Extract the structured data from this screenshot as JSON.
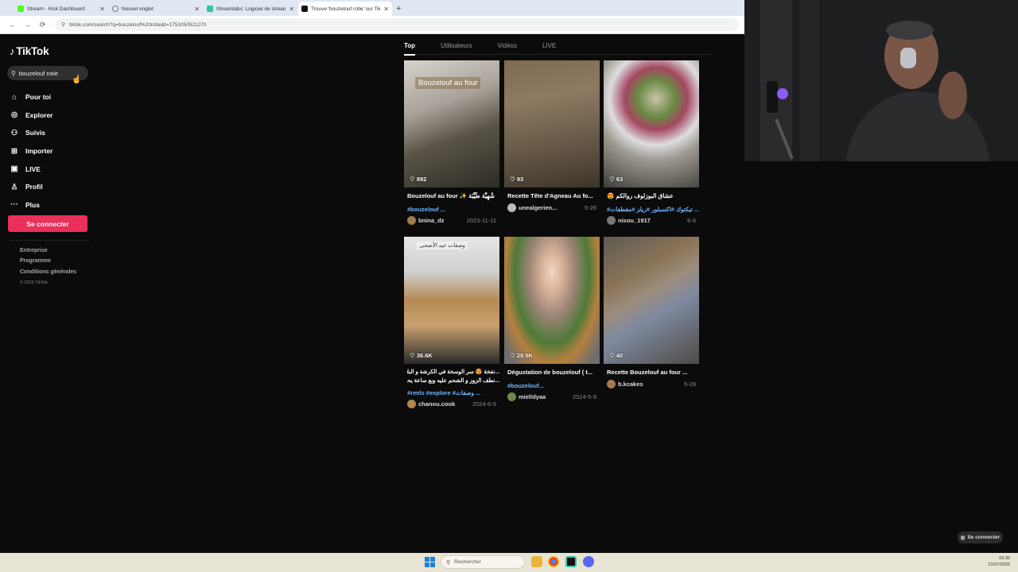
{
  "browser": {
    "tabs": [
      {
        "label": "Stream - Kick Dashboard",
        "color": "#53fc18"
      },
      {
        "label": "Nouvel onglet",
        "color": "#888888"
      },
      {
        "label": "Streamlabs: Logiciel de stream...",
        "color": "#31c3a2"
      },
      {
        "label": "Trouve 'bouzelouf rotie' sur Tik...",
        "color": "#111111"
      }
    ],
    "new_tab": "+",
    "url": "tiktok.com/search?q=bouzelouf%20rotie&t=1753050921270",
    "back": "←",
    "forward": "→",
    "reload": "⟳"
  },
  "sidebar": {
    "logo": "TikTok",
    "search_value": "bouzelouf rotie",
    "nav": [
      {
        "icon": "⌂",
        "label": "Pour toi"
      },
      {
        "icon": "◎",
        "label": "Explorer"
      },
      {
        "icon": "⚇",
        "label": "Suivis"
      },
      {
        "icon": "⊞",
        "label": "Importer"
      },
      {
        "icon": "▣",
        "label": "LIVE"
      },
      {
        "icon": "♙",
        "label": "Profil"
      },
      {
        "icon": "···",
        "label": "Plus"
      }
    ],
    "login": "Se connecter",
    "footer_links": [
      "Entreprise",
      "Programme",
      "Conditions générales"
    ],
    "copyright": "© 2025 TikTok"
  },
  "search_tabs": [
    "Top",
    "Utilisateurs",
    "Vidéos",
    "LIVE"
  ],
  "results": [
    {
      "likes": "892",
      "overlay": "Bouzelouf au four",
      "title": "Bouzelouf au four ✨ شْهِيَّة طَيِّبَة",
      "tags": "#bouzelouf ...",
      "user": "bnina_dz",
      "date": "2023-11-11"
    },
    {
      "likes": "93",
      "overlay": "",
      "title": "Recette Tête d'Agneau Au fo...",
      "tags": "",
      "user": "unealgerien...",
      "date": "5-28"
    },
    {
      "likes": "63",
      "overlay": "",
      "title": "عشاق البوزلوف روالكم 😍",
      "tags": "#تيكتوك #اكسبلور #ريلز #مقطفات ...",
      "user": "nisou_1917",
      "date": "6-6"
    },
    {
      "likes": "36.6K",
      "overlay": "وصفات عيد الأضحى",
      "title": "...نفخة 😍 سر الوسخة في الكرشة و البلايس",
      "title2": "...نطف الزوز و الشحم عليه وبع ساعة يحمار",
      "tags": "#reels #explore #وصفات ...",
      "user": "chanou.cook",
      "date": "2024-6-5"
    },
    {
      "likes": "29.5K",
      "overlay": "",
      "title": "Dégustation de bouzelouf ( t...",
      "tags": "#bouzelouf...",
      "user": "mielldyaa",
      "date": "2024-5-9"
    },
    {
      "likes": "40",
      "overlay": "",
      "title": "Recette Bouzelouf au four ...",
      "tags": "",
      "user": "b.kcakes",
      "date": "5-28"
    }
  ],
  "connect_pill": "Se connecter",
  "taskbar": {
    "search": "Rechercher",
    "time": "09:36",
    "date": "21/07/2025"
  }
}
